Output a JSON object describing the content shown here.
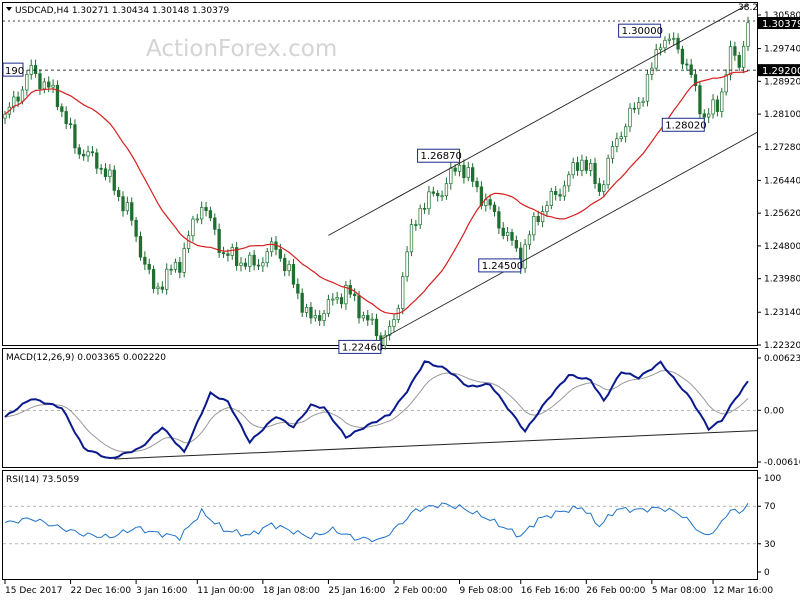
{
  "colors": {
    "candle": "#1f6f30",
    "ma": "#d81e1e",
    "macd": "#0a1a8c",
    "signal": "#9a9a9a",
    "rsi": "#1e73c8",
    "channel": "#222222",
    "grid": "#888888",
    "box_border": "#1a2a8a"
  },
  "watermark": "ActionForex.com",
  "chart_data": [
    {
      "type": "candlestick",
      "symbol_header": "USDCAD,H4  1.30271 1.30434 1.30148 1.30379",
      "ylim": [
        1.2232,
        1.3058
      ],
      "y_ticks": [
        "1.30580",
        "1.29740",
        "1.28920",
        "1.28100",
        "1.27280",
        "1.26440",
        "1.25620",
        "1.24800",
        "1.23980",
        "1.23140",
        "1.22320"
      ],
      "y_tick_values": [
        1.3058,
        1.2974,
        1.2892,
        1.281,
        1.2728,
        1.2644,
        1.2562,
        1.248,
        1.2398,
        1.2314,
        1.2232
      ],
      "last_price": "1.30379",
      "last_price_value": 1.30379,
      "hline_label": "1.29200",
      "hline_value": 1.292,
      "hline_left_label": "190",
      "fib_label": "38.2",
      "annotations": [
        {
          "text": "1.30000",
          "index": 150,
          "value": 1.3
        },
        {
          "text": "1.26870",
          "index": 104,
          "value": 1.2687
        },
        {
          "text": "1.24500",
          "index": 118,
          "value": 1.245
        },
        {
          "text": "1.28020",
          "index": 160,
          "value": 1.2802
        },
        {
          "text": "1.22460",
          "index": 86,
          "value": 1.2246
        }
      ],
      "anchors": [
        [
          0,
          1.28
        ],
        [
          6,
          1.292
        ],
        [
          12,
          1.285
        ],
        [
          16,
          1.273
        ],
        [
          22,
          1.268
        ],
        [
          28,
          1.257
        ],
        [
          34,
          1.237
        ],
        [
          40,
          1.244
        ],
        [
          45,
          1.259
        ],
        [
          50,
          1.246
        ],
        [
          57,
          1.243
        ],
        [
          62,
          1.248
        ],
        [
          70,
          1.229
        ],
        [
          78,
          1.237
        ],
        [
          86,
          1.2246
        ],
        [
          89,
          1.228
        ],
        [
          92,
          1.247
        ],
        [
          95,
          1.258
        ],
        [
          100,
          1.262
        ],
        [
          104,
          1.2687
        ],
        [
          110,
          1.259
        ],
        [
          114,
          1.252
        ],
        [
          118,
          1.245
        ],
        [
          122,
          1.256
        ],
        [
          127,
          1.262
        ],
        [
          132,
          1.27
        ],
        [
          136,
          1.262
        ],
        [
          140,
          1.275
        ],
        [
          145,
          1.284
        ],
        [
          148,
          1.292
        ],
        [
          150,
          1.3
        ],
        [
          154,
          1.298
        ],
        [
          157,
          1.29
        ],
        [
          160,
          1.2802
        ],
        [
          163,
          1.283
        ],
        [
          166,
          1.296
        ],
        [
          168,
          1.294
        ],
        [
          170,
          1.3038
        ]
      ],
      "ma_period": 20,
      "channel": {
        "lower": [
          [
            86,
            1.2246
          ],
          [
            180,
            1.2812
          ]
        ],
        "upper_point": [
          104,
          1.2687
        ]
      }
    },
    {
      "type": "line",
      "header": "MACD(12,26,9) 0.003365 0.002220",
      "ylim": [
        -0.00616,
        0.00623
      ],
      "y_ticks": [
        "0.006232",
        "0.00",
        "-0.006163"
      ],
      "y_tick_values": [
        0.00623,
        0.0,
        -0.00616
      ],
      "anchors": [
        [
          0,
          -0.0008
        ],
        [
          6,
          0.0014
        ],
        [
          13,
          0.0003
        ],
        [
          18,
          -0.0045
        ],
        [
          24,
          -0.0058
        ],
        [
          31,
          -0.0045
        ],
        [
          36,
          -0.002
        ],
        [
          41,
          -0.005
        ],
        [
          47,
          0.002
        ],
        [
          51,
          0.001
        ],
        [
          56,
          -0.0038
        ],
        [
          62,
          -0.0007
        ],
        [
          66,
          -0.002
        ],
        [
          70,
          0.0006
        ],
        [
          73,
          0.0003
        ],
        [
          78,
          -0.0032
        ],
        [
          83,
          -0.0018
        ],
        [
          88,
          -0.0005
        ],
        [
          92,
          0.0023
        ],
        [
          96,
          0.0058
        ],
        [
          101,
          0.0049
        ],
        [
          106,
          0.0028
        ],
        [
          111,
          0.0031
        ],
        [
          115,
          0.0003
        ],
        [
          119,
          -0.0025
        ],
        [
          124,
          0.0012
        ],
        [
          129,
          0.0042
        ],
        [
          134,
          0.0036
        ],
        [
          137,
          0.0011
        ],
        [
          141,
          0.0046
        ],
        [
          145,
          0.0039
        ],
        [
          150,
          0.0057
        ],
        [
          153,
          0.0038
        ],
        [
          157,
          0.0013
        ],
        [
          161,
          -0.0022
        ],
        [
          164,
          -0.0012
        ],
        [
          167,
          0.0013
        ],
        [
          170,
          0.0034
        ]
      ],
      "signal_period": 9,
      "support_line": [
        [
          25,
          -0.0058
        ],
        [
          182,
          -0.0022
        ]
      ]
    },
    {
      "type": "line",
      "header": "RSI(14) 73.5059",
      "ylim": [
        0,
        100
      ],
      "y_ticks": [
        "100",
        "70",
        "30",
        "0"
      ],
      "y_tick_values": [
        100,
        70,
        30,
        0
      ],
      "levels": [
        70,
        30
      ],
      "anchors": [
        [
          0,
          52
        ],
        [
          6,
          57
        ],
        [
          12,
          48
        ],
        [
          18,
          40
        ],
        [
          24,
          37
        ],
        [
          30,
          47
        ],
        [
          34,
          42
        ],
        [
          40,
          37
        ],
        [
          45,
          64
        ],
        [
          50,
          45
        ],
        [
          56,
          39
        ],
        [
          61,
          51
        ],
        [
          66,
          43
        ],
        [
          70,
          37
        ],
        [
          75,
          45
        ],
        [
          80,
          36
        ],
        [
          86,
          34
        ],
        [
          90,
          49
        ],
        [
          94,
          66
        ],
        [
          100,
          72
        ],
        [
          104,
          69
        ],
        [
          110,
          58
        ],
        [
          114,
          48
        ],
        [
          118,
          38
        ],
        [
          122,
          56
        ],
        [
          127,
          64
        ],
        [
          132,
          69
        ],
        [
          136,
          49
        ],
        [
          140,
          67
        ],
        [
          145,
          66
        ],
        [
          150,
          68
        ],
        [
          154,
          63
        ],
        [
          157,
          52
        ],
        [
          160,
          38
        ],
        [
          163,
          46
        ],
        [
          166,
          67
        ],
        [
          168,
          62
        ],
        [
          170,
          73.5
        ]
      ]
    }
  ],
  "x_axis": {
    "labels": [
      "15 Dec 2017",
      "22 Dec 16:00",
      "3 Jan 16:00",
      "11 Jan 00:00",
      "18 Jan 08:00",
      "25 Jan 16:00",
      "2 Feb 00:00",
      "9 Feb 08:00",
      "16 Feb 16:00",
      "26 Feb 00:00",
      "5 Mar 08:00",
      "12 Mar 16:00"
    ],
    "label_indices": [
      0,
      15,
      30,
      44,
      59,
      74,
      89,
      104,
      118,
      133,
      148,
      162
    ]
  }
}
